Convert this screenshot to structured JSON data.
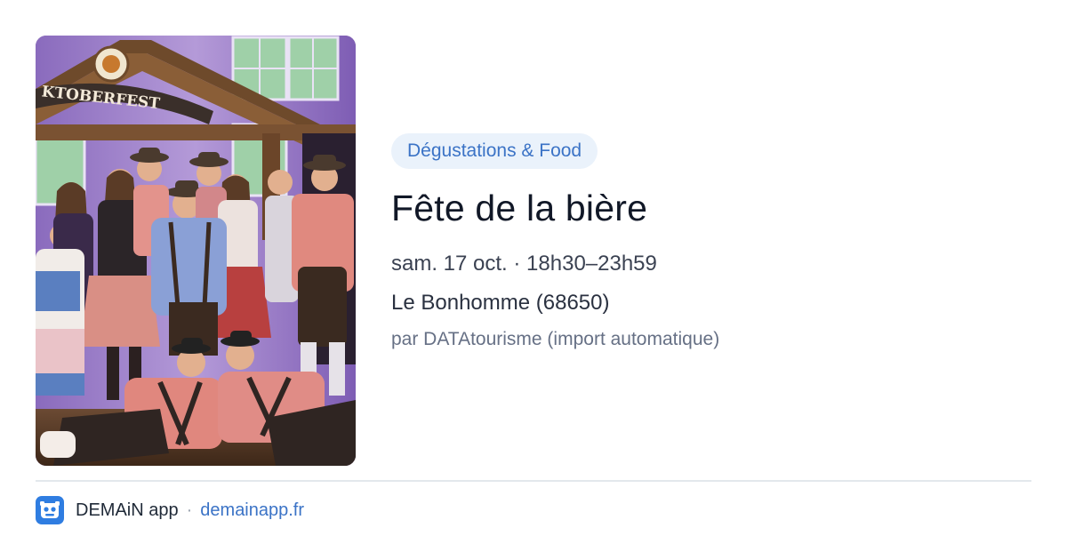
{
  "event": {
    "category": "Dégustations & Food",
    "title": "Fête de la bière",
    "datetime": "sam. 17 oct. · 18h30–23h59",
    "location": "Le Bonhomme (68650)",
    "source": "par DATAtourisme (import automatique)",
    "photo_sign_text": "KTOBERFEST"
  },
  "footer": {
    "app_name": "DEMAiN app",
    "separator": "·",
    "url": "demainapp.fr"
  },
  "colors": {
    "accent": "#3b73c6",
    "tag_bg": "#eaf2fb",
    "app_icon": "#2f7de1"
  },
  "icons": {
    "app": "robot-face-icon"
  }
}
